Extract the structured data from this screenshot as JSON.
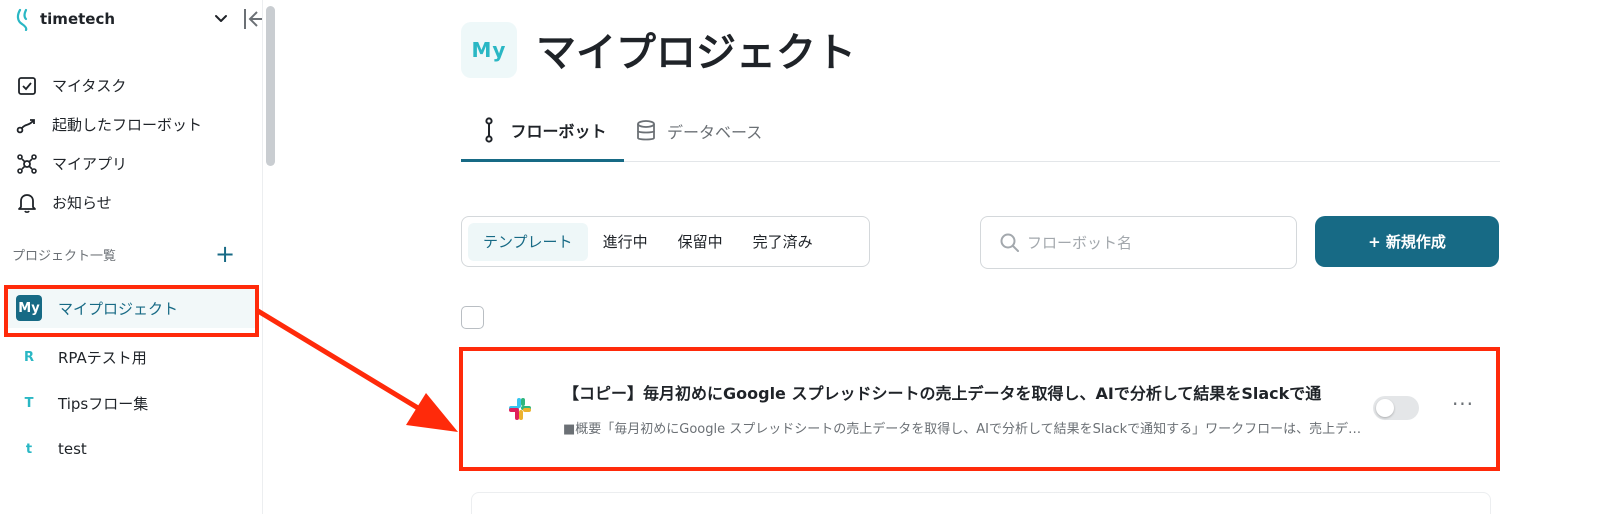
{
  "sidebar": {
    "brand": "timetech",
    "nav": [
      {
        "label": "マイタスク",
        "icon": "checkbox-icon"
      },
      {
        "label": "起動したフローボット",
        "icon": "flow-icon"
      },
      {
        "label": "マイアプリ",
        "icon": "apps-icon"
      },
      {
        "label": "お知らせ",
        "icon": "bell-icon"
      }
    ],
    "projects_heading": "プロジェクト一覧",
    "projects_add": "+",
    "projects": [
      {
        "badge": "My",
        "label": "マイプロジェクト",
        "active": true
      },
      {
        "badge": "R",
        "label": "RPAテスト用"
      },
      {
        "badge": "T",
        "label": "Tipsフロー集"
      },
      {
        "badge": "t",
        "label": "test"
      }
    ]
  },
  "main": {
    "badge": "My",
    "title": "マイプロジェクト",
    "tabs": [
      {
        "label": "フローボット",
        "active": true
      },
      {
        "label": "データベース"
      }
    ],
    "filters": [
      "テンプレート",
      "進行中",
      "保留中",
      "完了済み"
    ],
    "search_placeholder": "フローボット名",
    "new_button": "+ 新規作成",
    "flow": {
      "title": "【コピー】毎月初めにGoogle スプレッドシートの売上データを取得し、AIで分析して結果をSlackで通",
      "description": "■概要「毎月初めにGoogle スプレッドシートの売上データを取得し、AIで分析して結果をSlackで通知する」ワークフローは、売上データの集計",
      "enabled": false,
      "more": "···"
    }
  },
  "colors": {
    "accent": "#176a85",
    "accent_light": "#2ab7c4",
    "highlight": "#ff2a0a"
  }
}
